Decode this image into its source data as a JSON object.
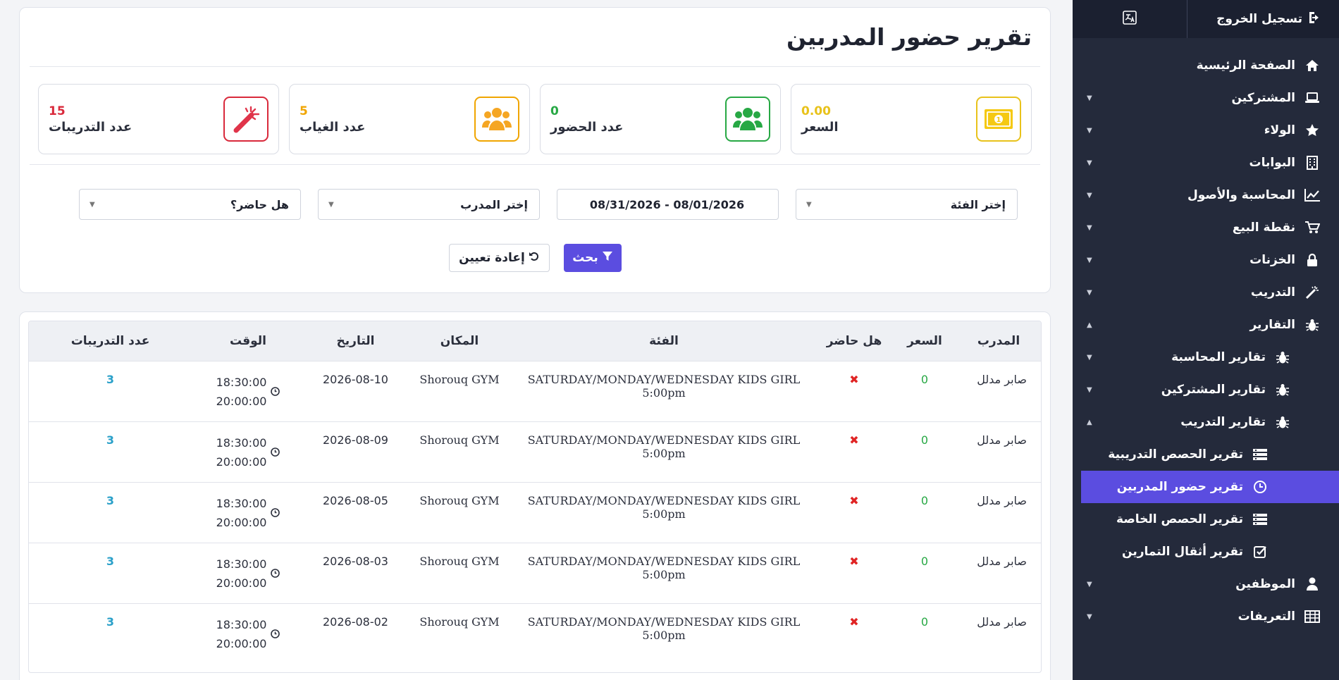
{
  "page": {
    "title": "تقرير حضور المدربين"
  },
  "sidebar": {
    "logout_label": "تسجيل الخروج",
    "items": [
      {
        "label": "الصفحة الرئيسية",
        "icon": "home-icon",
        "caret": ""
      },
      {
        "label": "المشتركين",
        "icon": "laptop-icon",
        "caret": "▼"
      },
      {
        "label": "الولاء",
        "icon": "star-icon",
        "caret": "▼"
      },
      {
        "label": "البوابات",
        "icon": "building-icon",
        "caret": "▼"
      },
      {
        "label": "المحاسبة والأصول",
        "icon": "chart-line-icon",
        "caret": "▼"
      },
      {
        "label": "نقطة البيع",
        "icon": "cart-icon",
        "caret": "▼"
      },
      {
        "label": "الخزنات",
        "icon": "lock-icon",
        "caret": "▼"
      },
      {
        "label": "التدريب",
        "icon": "wand-icon",
        "caret": "▼"
      },
      {
        "label": "التقارير",
        "icon": "bug-icon",
        "caret": "▲"
      },
      {
        "label": "تقارير المحاسبة",
        "icon": "bug-icon",
        "caret": "▼"
      },
      {
        "label": "تقارير المشتركين",
        "icon": "bug-icon",
        "caret": "▼"
      },
      {
        "label": "تقارير التدريب",
        "icon": "bug-icon",
        "caret": "▲"
      },
      {
        "label": "تقرير الحصص التدريبية",
        "icon": "list-icon",
        "caret": ""
      },
      {
        "label": "تقرير حضور المدربين",
        "icon": "clock-icon",
        "caret": ""
      },
      {
        "label": "تقرير الحصص الخاصة",
        "icon": "list-icon",
        "caret": ""
      },
      {
        "label": "تقرير أثقال التمارين",
        "icon": "check-square-icon",
        "caret": ""
      },
      {
        "label": "الموظفين",
        "icon": "user-icon",
        "caret": "▼"
      },
      {
        "label": "التعريفات",
        "icon": "table-icon",
        "caret": "▼"
      }
    ]
  },
  "stats": [
    {
      "label": "السعر",
      "value": "0.00",
      "color": "#e8c21b",
      "icon": "money-icon"
    },
    {
      "label": "عدد الحضور",
      "value": "0",
      "color": "#27a844",
      "icon": "users-icon"
    },
    {
      "label": "عدد الغياب",
      "value": "5",
      "color": "#f0a500",
      "icon": "users-icon"
    },
    {
      "label": "عدد التدريبات",
      "value": "15",
      "color": "#d9293b",
      "icon": "wand-icon"
    }
  ],
  "filters": {
    "category": "إختر الفئة",
    "date_range": "08/31/2026 - 08/01/2026",
    "coach": "إختر المدرب",
    "present": "هل حاضر؟"
  },
  "buttons": {
    "search": "بحث",
    "reset": "إعادة تعيين"
  },
  "table": {
    "headers": [
      "المدرب",
      "السعر",
      "هل حاضر",
      "الفئة",
      "المكان",
      "التاريخ",
      "الوقت",
      "عدد التدريبات"
    ],
    "rows": [
      {
        "coach": "صابر مدلل",
        "price": "0",
        "present": "✖",
        "category": "SATURDAY/MONDAY/WEDNESDAY KIDS GIRL 5:00pm",
        "place": "Shorouq GYM",
        "date": "2026-08-10",
        "time_from": "18:30:00",
        "time_to": "20:00:00",
        "count": "3"
      },
      {
        "coach": "صابر مدلل",
        "price": "0",
        "present": "✖",
        "category": "SATURDAY/MONDAY/WEDNESDAY KIDS GIRL 5:00pm",
        "place": "Shorouq GYM",
        "date": "2026-08-09",
        "time_from": "18:30:00",
        "time_to": "20:00:00",
        "count": "3"
      },
      {
        "coach": "صابر مدلل",
        "price": "0",
        "present": "✖",
        "category": "SATURDAY/MONDAY/WEDNESDAY KIDS GIRL 5:00pm",
        "place": "Shorouq GYM",
        "date": "2026-08-05",
        "time_from": "18:30:00",
        "time_to": "20:00:00",
        "count": "3"
      },
      {
        "coach": "صابر مدلل",
        "price": "0",
        "present": "✖",
        "category": "SATURDAY/MONDAY/WEDNESDAY KIDS GIRL 5:00pm",
        "place": "Shorouq GYM",
        "date": "2026-08-03",
        "time_from": "18:30:00",
        "time_to": "20:00:00",
        "count": "3"
      },
      {
        "coach": "صابر مدلل",
        "price": "0",
        "present": "✖",
        "category": "SATURDAY/MONDAY/WEDNESDAY KIDS GIRL 5:00pm",
        "place": "Shorouq GYM",
        "date": "2026-08-02",
        "time_from": "18:30:00",
        "time_to": "20:00:00",
        "count": "3"
      }
    ]
  },
  "theme": {
    "sidebar_bg": "#242a3b",
    "accent": "#5b4de0",
    "success": "#27a844",
    "danger": "#d9293b",
    "warning": "#f0a500"
  }
}
